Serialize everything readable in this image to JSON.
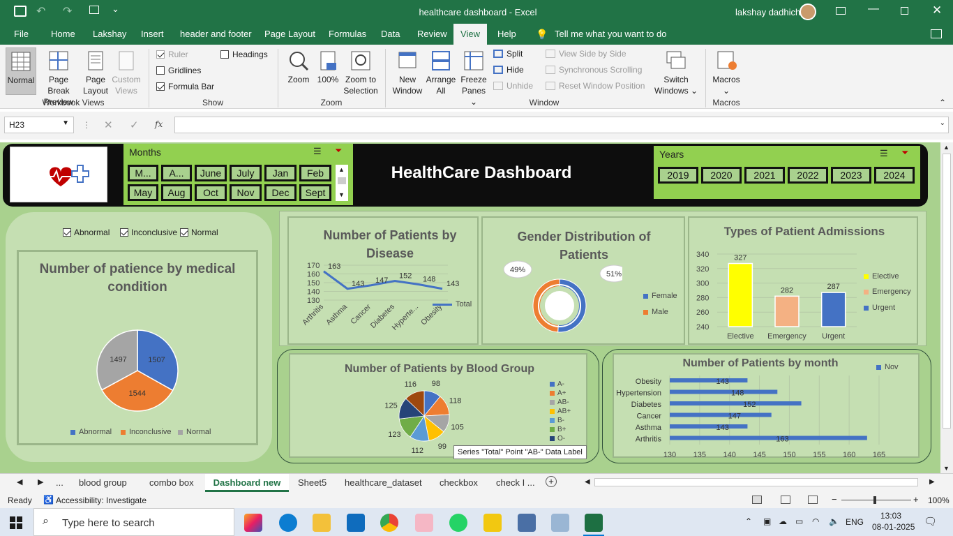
{
  "window": {
    "title": "healthcare dashboard  -  Excel",
    "user": "lakshay dadhich"
  },
  "menu": [
    "File",
    "Home",
    "Lakshay",
    "Insert",
    "header and footer",
    "Page Layout",
    "Formulas",
    "Data",
    "Review",
    "View",
    "Help"
  ],
  "tell_me": "Tell me what you want to do",
  "ribbon": {
    "workbook_views": {
      "normal": "Normal",
      "page_break": [
        "Page Break",
        "Preview"
      ],
      "page_layout": [
        "Page",
        "Layout"
      ],
      "custom": [
        "Custom",
        "Views"
      ],
      "label": "Workbook Views"
    },
    "show": {
      "ruler": "Ruler",
      "gridlines": "Gridlines",
      "formula_bar": "Formula Bar",
      "headings": "Headings",
      "label": "Show"
    },
    "zoom": {
      "zoom": "Zoom",
      "hundred": "100%",
      "sel": [
        "Zoom to",
        "Selection"
      ],
      "label": "Zoom"
    },
    "window": {
      "new": [
        "New",
        "Window"
      ],
      "arrange": [
        "Arrange",
        "All"
      ],
      "freeze": [
        "Freeze",
        "Panes"
      ],
      "split": "Split",
      "hide": "Hide",
      "unhide": "Unhide",
      "side": "View Side by Side",
      "sync": "Synchronous Scrolling",
      "reset": "Reset Window Position",
      "switch": [
        "Switch",
        "Windows"
      ],
      "label": "Window"
    },
    "macros": {
      "macros": "Macros",
      "label": "Macros"
    }
  },
  "formula": {
    "namebox": "H23",
    "fx": "fx"
  },
  "dashboard": {
    "title": "HealthCare Dashboard",
    "months_slicer": {
      "title": "Months",
      "items": [
        "M...",
        "A...",
        "June",
        "July",
        "Jan",
        "Feb",
        "May",
        "Aug",
        "Oct",
        "Nov",
        "Dec",
        "Sept"
      ]
    },
    "years_slicer": {
      "title": "Years",
      "items": [
        "2019",
        "2020",
        "2021",
        "2022",
        "2023",
        "2024"
      ]
    },
    "checkboxes": [
      {
        "label": "Abnormal",
        "checked": true
      },
      {
        "label": "Inconclusive",
        "checked": true
      },
      {
        "label": "Normal",
        "checked": true
      }
    ],
    "tooltip": "Series \"Total\" Point \"AB-\" Data Label"
  },
  "chart_data": [
    {
      "type": "pie",
      "title": "Number of patience by medical condition",
      "categories": [
        "Abnormal",
        "Inconclusive",
        "Normal"
      ],
      "values": [
        1507,
        1544,
        1497
      ],
      "colors": [
        "#4472c4",
        "#ed7d31",
        "#a5a5a5"
      ]
    },
    {
      "type": "line",
      "title": "Number of Patients by Disease",
      "categories": [
        "Arthritis",
        "Asthma",
        "Cancer",
        "Diabetes",
        "Hyperte...",
        "Obesity"
      ],
      "series": [
        {
          "name": "Total",
          "values": [
            163,
            143,
            147,
            152,
            148,
            143
          ]
        }
      ],
      "yticks": [
        "170",
        "160",
        "150",
        "140",
        "130"
      ],
      "ylim": [
        130,
        170
      ]
    },
    {
      "type": "pie",
      "title": "Gender Distribution of Patients",
      "categories": [
        "Female",
        "Male"
      ],
      "values": [
        51,
        49
      ],
      "labels": [
        "51%",
        "49%"
      ],
      "colors": [
        "#4472c4",
        "#ed7d31"
      ]
    },
    {
      "type": "bar",
      "title": "Types of Patient Admissions",
      "categories": [
        "Elective",
        "Emergency",
        "Urgent"
      ],
      "values": [
        327,
        282,
        287
      ],
      "colors": [
        "#ffff00",
        "#f4b183",
        "#4472c4"
      ],
      "yticks": [
        "340",
        "320",
        "300",
        "280",
        "260",
        "240"
      ],
      "ylim": [
        240,
        340
      ]
    },
    {
      "type": "pie",
      "title": "Number of Patients by Blood Group",
      "categories": [
        "A-",
        "A+",
        "AB-",
        "AB+",
        "B-",
        "B+",
        "O-",
        "O+"
      ],
      "values": [
        98,
        118,
        105,
        99,
        112,
        123,
        125,
        116
      ],
      "legend": [
        "A-",
        "A+",
        "AB-",
        "AB+",
        "B-",
        "B+",
        "O-"
      ],
      "colors": [
        "#4472c4",
        "#ed7d31",
        "#a5a5a5",
        "#ffc000",
        "#5b9bd5",
        "#70ad47",
        "#264478",
        "#9e480e"
      ]
    },
    {
      "type": "bar",
      "title": "Number of Patients by month",
      "categories": [
        "Obesity",
        "Hypertension",
        "Diabetes",
        "Cancer",
        "Asthma",
        "Arthritis"
      ],
      "series": [
        {
          "name": "Nov",
          "values": [
            143,
            148,
            152,
            147,
            143,
            163
          ]
        }
      ],
      "xticks": [
        "130",
        "135",
        "140",
        "145",
        "150",
        "155",
        "160",
        "165"
      ],
      "xlim": [
        130,
        165
      ]
    }
  ],
  "sheet_tabs": [
    "...",
    "blood group",
    "combo box",
    "Dashboard new",
    "Sheet5",
    "healthcare_dataset",
    "checkbox",
    "check I ..."
  ],
  "status": {
    "ready": "Ready",
    "accessibility": "Accessibility: Investigate",
    "zoom": "100%"
  },
  "taskbar": {
    "search": "Type here to search",
    "lang": "ENG",
    "time": "13:03",
    "date": "08-01-2025"
  }
}
